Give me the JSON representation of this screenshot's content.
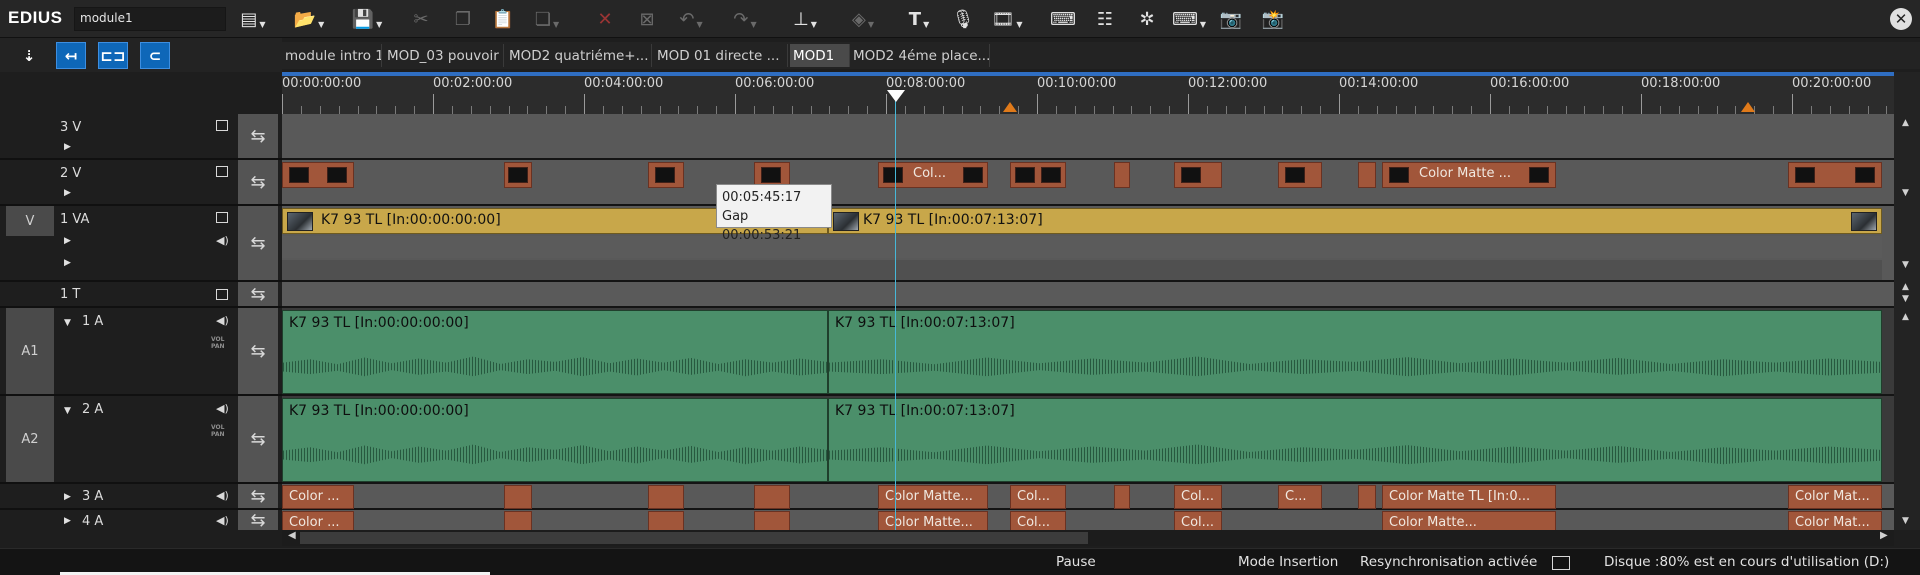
{
  "app": {
    "name": "EDIUS",
    "project": "module1"
  },
  "toolbar": {
    "icons": [
      "new-project-icon",
      "open-folder-icon",
      "save-icon",
      "cut-icon",
      "copy-icon",
      "paste-icon",
      "paste-insert-icon",
      "delete-icon",
      "ripple-delete-icon",
      "undo-icon",
      "redo-icon",
      "marker-tool-icon",
      "group-icon",
      "title-icon",
      "voice-over-icon",
      "render-icon",
      "keyboard-icon",
      "mixer-icon",
      "effects-icon",
      "shortcut-icon",
      "snapshot-icon",
      "capture-icon"
    ]
  },
  "sequence_tabs": [
    {
      "label": "module intro 1",
      "active": false
    },
    {
      "label": "MOD_03 pouvoir",
      "active": false
    },
    {
      "label": "MOD2 quatriéme+...",
      "active": false
    },
    {
      "label": "MOD 01 directe ...",
      "active": false
    },
    {
      "label": "MOD1",
      "active": true
    },
    {
      "label": "MOD2 4éme place...",
      "active": false
    }
  ],
  "va_header": {
    "v": "V",
    "a": "A",
    "range_value": "-----"
  },
  "ruler": {
    "labels": [
      "00:00:00:00",
      "00:02:00:00",
      "00:04:00:00",
      "00:06:00:00",
      "00:08:00:00",
      "00:10:00:00",
      "00:12:00:00",
      "00:14:00:00",
      "00:16:00:00",
      "00:18:00:00",
      "00:20:00:00"
    ]
  },
  "tracks": {
    "v3": {
      "label": "3 V"
    },
    "v2": {
      "label": "2 V"
    },
    "va1": {
      "label": "1 VA",
      "patch": "V"
    },
    "t1": {
      "label": "1 T"
    },
    "a1": {
      "label": "1 A",
      "patch": "A1"
    },
    "a2": {
      "label": "2 A",
      "patch": "A2"
    },
    "a3": {
      "label": "3 A"
    },
    "a4": {
      "label": "4 A"
    }
  },
  "clips": {
    "v2_color_matte_short": "Col...",
    "v2_color_matte_long": "Color Matte  ...",
    "va1_clip1": "K7 93  TL [In:00:00:00:00]",
    "va1_clip2": "K7 93  TL [In:00:07:13:07]",
    "a_clip1": "K7 93  TL [In:00:00:00:00]",
    "a_clip2": "K7 93  TL [In:00:07:13:07]",
    "a3_color": "Color ...",
    "a3_matte": "Color Matte...",
    "a3_col": "Col...",
    "a3_c": "C...",
    "a3_tl": "Color Matte  TL [In:0...",
    "a3_end": "Color Mat...",
    "a4_color": "Color ...",
    "a4_matte": "Color Matte...",
    "a4_col": "Col...",
    "a4_end": "Color Mat..."
  },
  "tooltip": {
    "time": "00:05:45:17",
    "gap": "Gap 00:00:53:21"
  },
  "status": {
    "state": "Pause",
    "mode": "Mode Insertion",
    "resync": "Resynchronisation activée",
    "disk": "Disque :80% est en cours d'utilisation (D:)"
  },
  "colors": {
    "accent": "#0e67b8",
    "video_clip": "#c8a74a",
    "audio_clip": "#4b8f6a",
    "color_matte": "#a1563a",
    "playhead": "#47b8d8",
    "marker": "#e07a1a"
  }
}
